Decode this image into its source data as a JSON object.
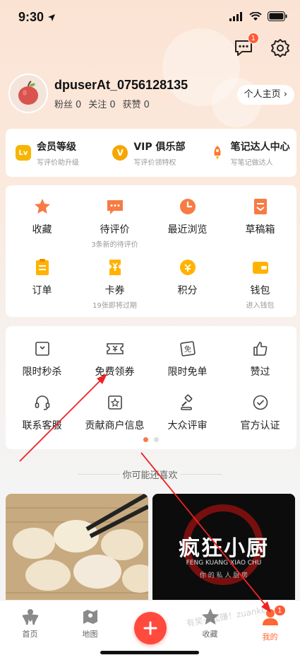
{
  "status_bar": {
    "time": "9:30"
  },
  "header": {
    "message_badge": "1"
  },
  "profile": {
    "username": "dpuserAt_0756128135",
    "fans_label": "粉丝",
    "fans_count": "0",
    "follow_label": "关注",
    "follow_count": "0",
    "likes_label": "获赞",
    "likes_count": "0",
    "homepage_button": "个人主页 ›"
  },
  "membership": [
    {
      "title": "会员等级",
      "subtitle": "写评价助升级",
      "icon": "level-icon",
      "color": "#f7b500"
    },
    {
      "title": "VIP 俱乐部",
      "subtitle": "写评价领特权",
      "icon": "vip-icon",
      "color": "#f7a600"
    },
    {
      "title": "笔记达人中心",
      "subtitle": "写笔记做达人",
      "icon": "rocket-icon",
      "color": "#ff7a2d"
    }
  ],
  "grid1": [
    {
      "label": "收藏",
      "sub": "",
      "icon": "star-icon"
    },
    {
      "label": "待评价",
      "sub": "3条新的待评价",
      "icon": "comment-icon"
    },
    {
      "label": "最近浏览",
      "sub": "",
      "icon": "clock-icon"
    },
    {
      "label": "草稿箱",
      "sub": "",
      "icon": "draft-icon"
    },
    {
      "label": "订单",
      "sub": "",
      "icon": "order-icon"
    },
    {
      "label": "卡券",
      "sub": "19张即将过期",
      "icon": "coupon-icon"
    },
    {
      "label": "积分",
      "sub": "",
      "icon": "points-icon"
    },
    {
      "label": "钱包",
      "sub": "进入钱包",
      "icon": "wallet-icon"
    }
  ],
  "grid2": [
    {
      "label": "限时秒杀",
      "icon": "flash-sale-icon"
    },
    {
      "label": "免费领券",
      "icon": "free-coupon-icon"
    },
    {
      "label": "限时免单",
      "icon": "free-order-icon"
    },
    {
      "label": "赞过",
      "icon": "thumbs-up-icon"
    },
    {
      "label": "联系客服",
      "icon": "headset-icon"
    },
    {
      "label": "贡献商户信息",
      "icon": "shop-info-icon"
    },
    {
      "label": "大众评审",
      "icon": "gavel-icon"
    },
    {
      "label": "官方认证",
      "icon": "verified-icon"
    }
  ],
  "recommend_title": "你可能还喜欢",
  "feed": {
    "right_title": "疯狂小厨",
    "right_subtitle": "FENG KUANG XIAO CHU",
    "right_caption": "你 的 私 人 厨 房"
  },
  "tabbar": [
    {
      "label": "首页",
      "icon": "home-icon"
    },
    {
      "label": "地图",
      "icon": "map-icon"
    },
    {
      "label": "",
      "icon": "plus-icon"
    },
    {
      "label": "收藏",
      "icon": "favorites-icon"
    },
    {
      "label": "我的",
      "icon": "me-icon",
      "badge": "1"
    }
  ],
  "watermark": "有奖一起赚！zuanke8",
  "colors": {
    "accent": "#ff6633",
    "primary_orange": "#f77b44",
    "plus_red": "#ff4a3d"
  }
}
